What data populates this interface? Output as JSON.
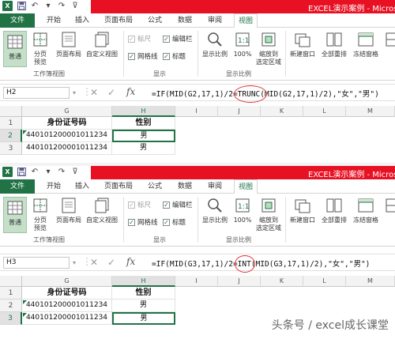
{
  "window": {
    "title": "EXCEL演示案例 - Microso"
  },
  "tabs": [
    "文件",
    "开始",
    "插入",
    "页面布局",
    "公式",
    "数据",
    "审阅",
    "视图"
  ],
  "ribbon": {
    "normal": "普通",
    "page_break_l1": "分页",
    "page_break_l2": "预览",
    "page_layout": "页面布局",
    "custom_views": "自定义视图",
    "ruler": "标尺",
    "formula_bar": "编辑栏",
    "gridlines": "网格线",
    "headings": "标题",
    "zoom": "显示比例",
    "zoom100": "100%",
    "zoom_sel_l1": "缩放到",
    "zoom_sel_l2": "选定区域",
    "new_window": "新建窗口",
    "arrange_all": "全部重排",
    "freeze": "冻结窗格",
    "grp_views": "工作簿视图",
    "grp_show": "显示",
    "grp_zoom": "显示比例"
  },
  "panels": [
    {
      "name_box": "H2",
      "formula_pre": "=IF(MID(G2,17,1)/2=",
      "formula_hl": "TRUNC",
      "formula_post": "(MID(G2,17,1)/2),\"女\",\"男\")",
      "col_headers": [
        "G",
        "H",
        "I",
        "J",
        "K",
        "L",
        "M"
      ],
      "rows": [
        "1",
        "2",
        "3"
      ],
      "header_id": "身份证号码",
      "header_gender": "性别",
      "data": [
        {
          "id": "440101200001011234",
          "gender": "男"
        },
        {
          "id": "440101200001011234",
          "gender": "男"
        }
      ]
    },
    {
      "name_box": "H3",
      "formula_pre": "=IF(MID(G3,17,1)/2=",
      "formula_hl": "INT",
      "formula_post": "(MID(G3,17,1)/2),\"女\",\"男\")",
      "col_headers": [
        "G",
        "H",
        "I",
        "J",
        "K",
        "L",
        "M"
      ],
      "rows": [
        "1",
        "2",
        "3"
      ],
      "header_id": "身份证号码",
      "header_gender": "性别",
      "data": [
        {
          "id": "440101200001011234",
          "gender": "男"
        },
        {
          "id": "440101200001011234",
          "gender": "男"
        }
      ]
    }
  ],
  "watermark": "头条号 / excel成长课堂",
  "colors": {
    "excel_green": "#217346",
    "title_red": "#e81123",
    "highlight_circle": "#e03030"
  }
}
